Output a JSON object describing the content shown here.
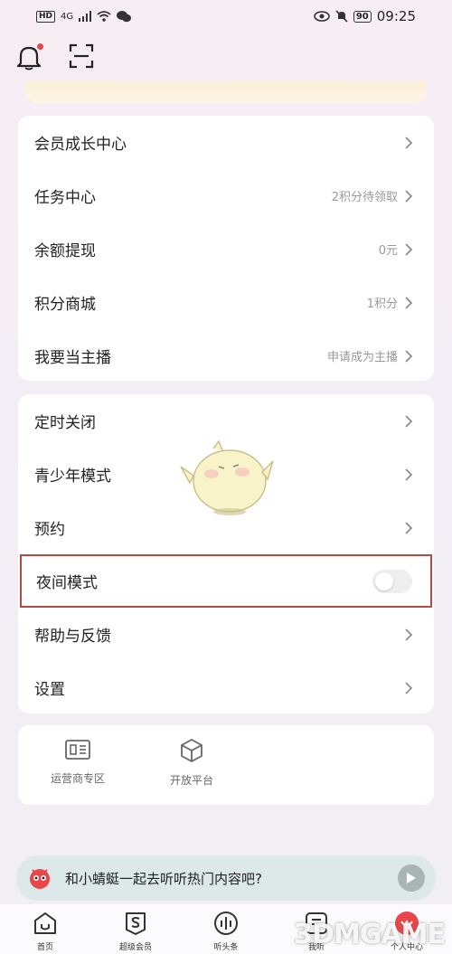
{
  "status_bar": {
    "left_badge": "HD",
    "signal": "4G",
    "battery": "90",
    "time": "09:25"
  },
  "top_actions": {
    "bell_icon": "bell-icon",
    "scan_icon": "scan-icon"
  },
  "card_growth": {
    "items": [
      {
        "label": "会员成长中心",
        "value": ""
      },
      {
        "label": "任务中心",
        "value": "2积分待领取"
      },
      {
        "label": "余额提现",
        "value": "0元"
      },
      {
        "label": "积分商城",
        "value": "1积分"
      },
      {
        "label": "我要当主播",
        "value": "申请成为主播"
      }
    ]
  },
  "card_settings": {
    "items": [
      {
        "label": "定时关闭"
      },
      {
        "label": "青少年模式"
      },
      {
        "label": "预约"
      },
      {
        "label": "夜间模式",
        "toggle": false
      },
      {
        "label": "帮助与反馈"
      },
      {
        "label": "设置"
      }
    ]
  },
  "quick_links": [
    {
      "label": "运营商专区",
      "icon": "operator-card-icon"
    },
    {
      "label": "开放平台",
      "icon": "cube-icon"
    }
  ],
  "promo": {
    "text": "和小蜻蜓一起去听听热门内容吧?"
  },
  "tab_bar": [
    {
      "label": "首页",
      "icon": "home-icon"
    },
    {
      "label": "超级会员",
      "icon": "vip-icon"
    },
    {
      "label": "听头条",
      "icon": "headline-icon"
    },
    {
      "label": "我听",
      "icon": "listen-icon"
    },
    {
      "label": "个人中心",
      "icon": "profile-icon"
    }
  ],
  "watermark": "3DMGAME",
  "colors": {
    "accent_red": "#e8464b",
    "highlight_border": "#b34a45",
    "promo_bg": "#dce9e8"
  }
}
